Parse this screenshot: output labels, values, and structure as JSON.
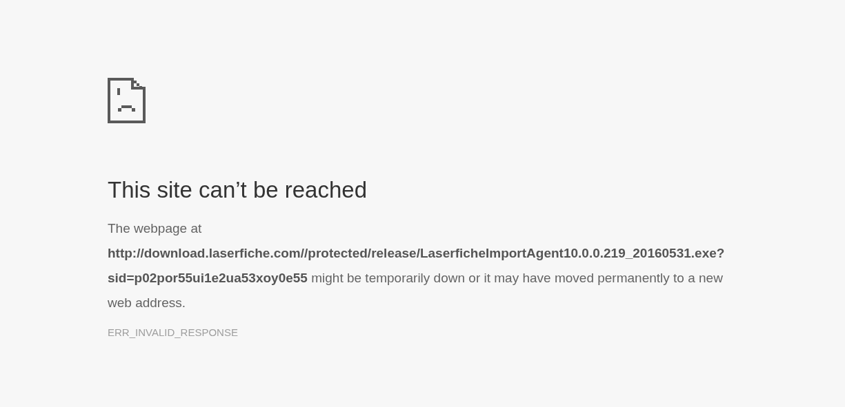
{
  "heading": "This site can’t be reached",
  "message": "The webpage at **http://download.laserfiche.com//protected/release/LaserficheImportAgent10.0.0.219_20160531.exe?sid=p02por55ui1e2ua53xoy0e55** might be temporarily down or it may have moved permanently to a new web address.",
  "error_code": "ERR_INVALID_RESPONSE"
}
